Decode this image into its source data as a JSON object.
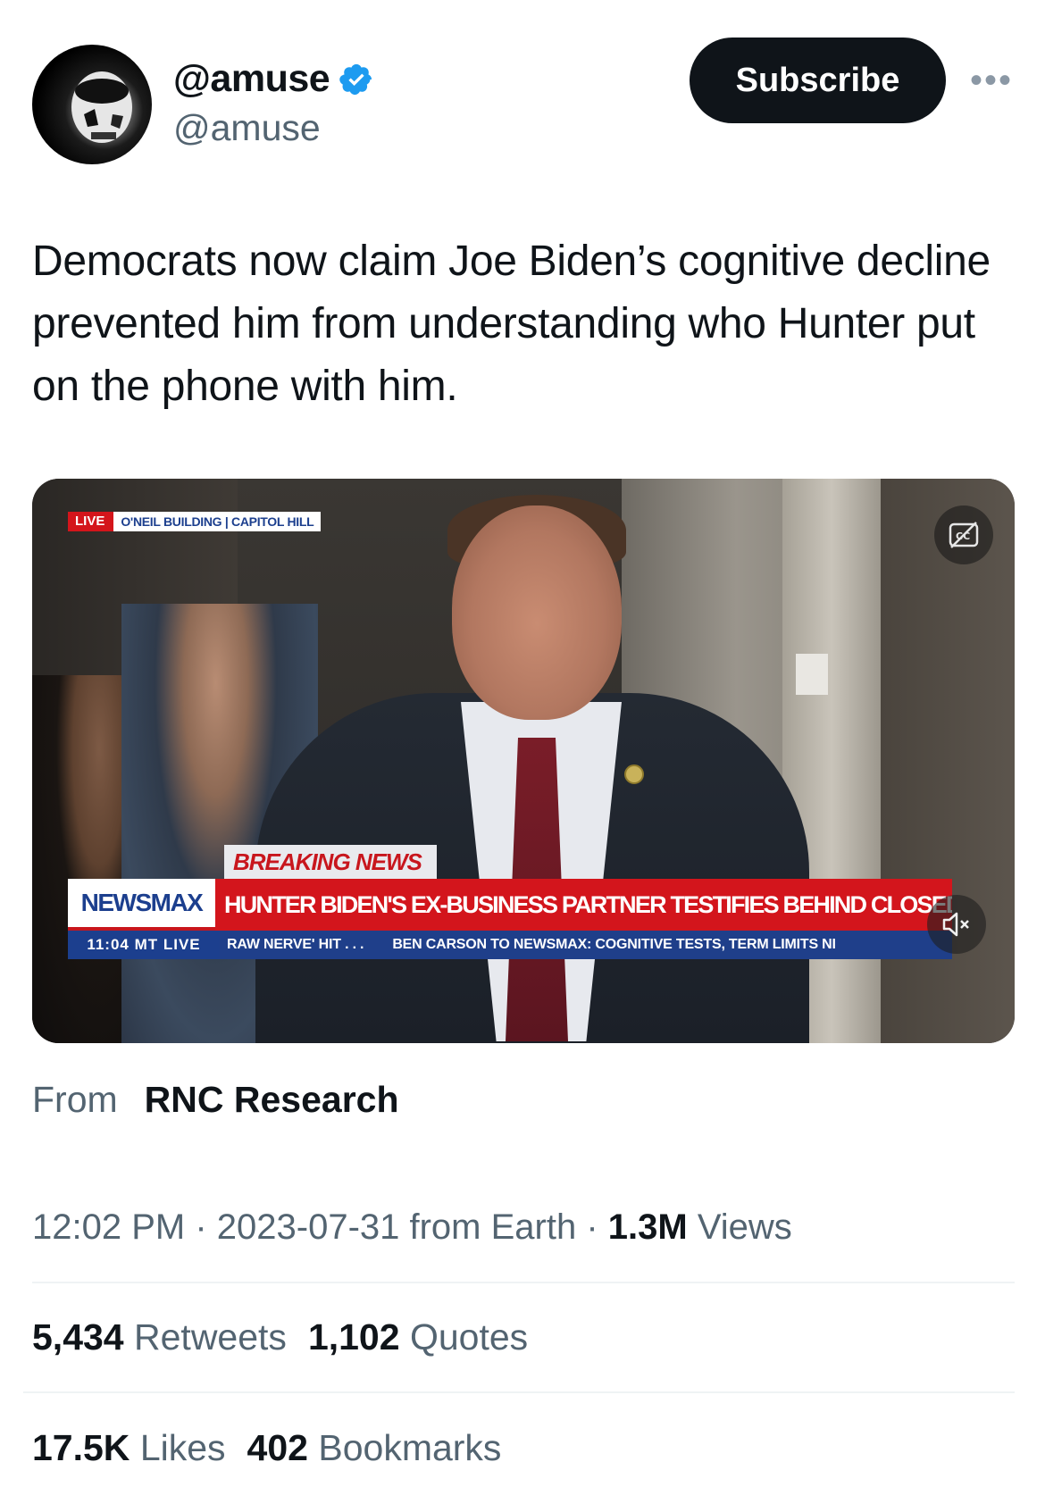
{
  "author": {
    "display_name": "@amuse",
    "handle": "@amuse",
    "verified": true,
    "avatar_icon": "stormtrooper-avatar-icon"
  },
  "header": {
    "subscribe_label": "Subscribe",
    "more_icon": "more-options-icon",
    "more_label": "•••"
  },
  "tweet": {
    "text": "Democrats now claim Joe Biden’s cognitive decline prevented him from understanding who Hunter put on the phone with him."
  },
  "video": {
    "live_tag": "LIVE",
    "location_tag": "O'NEIL BUILDING | CAPITOL HILL",
    "breaking_label": "BREAKING NEWS",
    "network_logo": "NEWSMAX",
    "headline": "HUNTER BIDEN'S EX-BUSINESS PARTNER TESTIFIES BEHIND CLOSED DOORS",
    "ticker_time": "11:04 MT  LIVE",
    "ticker_items": [
      "RAW NERVE' HIT . . .",
      "BEN CARSON TO NEWSMAX: COGNITIVE TESTS, TERM LIMITS NI"
    ],
    "cc_icon": "closed-captions-off-icon",
    "mute_icon": "muted-speaker-icon"
  },
  "attribution": {
    "from_label": "From",
    "source": "RNC Research"
  },
  "meta": {
    "time": "12:02 PM",
    "sep1": " · ",
    "date": "2023-07-31",
    "location": " from Earth",
    "sep2": " · ",
    "views_count": "1.3M",
    "views_label": " Views"
  },
  "stats": {
    "retweets_count": "5,434",
    "retweets_label": "Retweets",
    "quotes_count": "1,102",
    "quotes_label": "Quotes",
    "likes_count": "17.5K",
    "likes_label": "Likes",
    "bookmarks_count": "402",
    "bookmarks_label": "Bookmarks"
  },
  "colors": {
    "verified_blue": "#1d9bf0",
    "text_primary": "#0f1419",
    "text_secondary": "#536471",
    "newsmax_red": "#d3151c",
    "newsmax_blue": "#1c3f8e"
  }
}
